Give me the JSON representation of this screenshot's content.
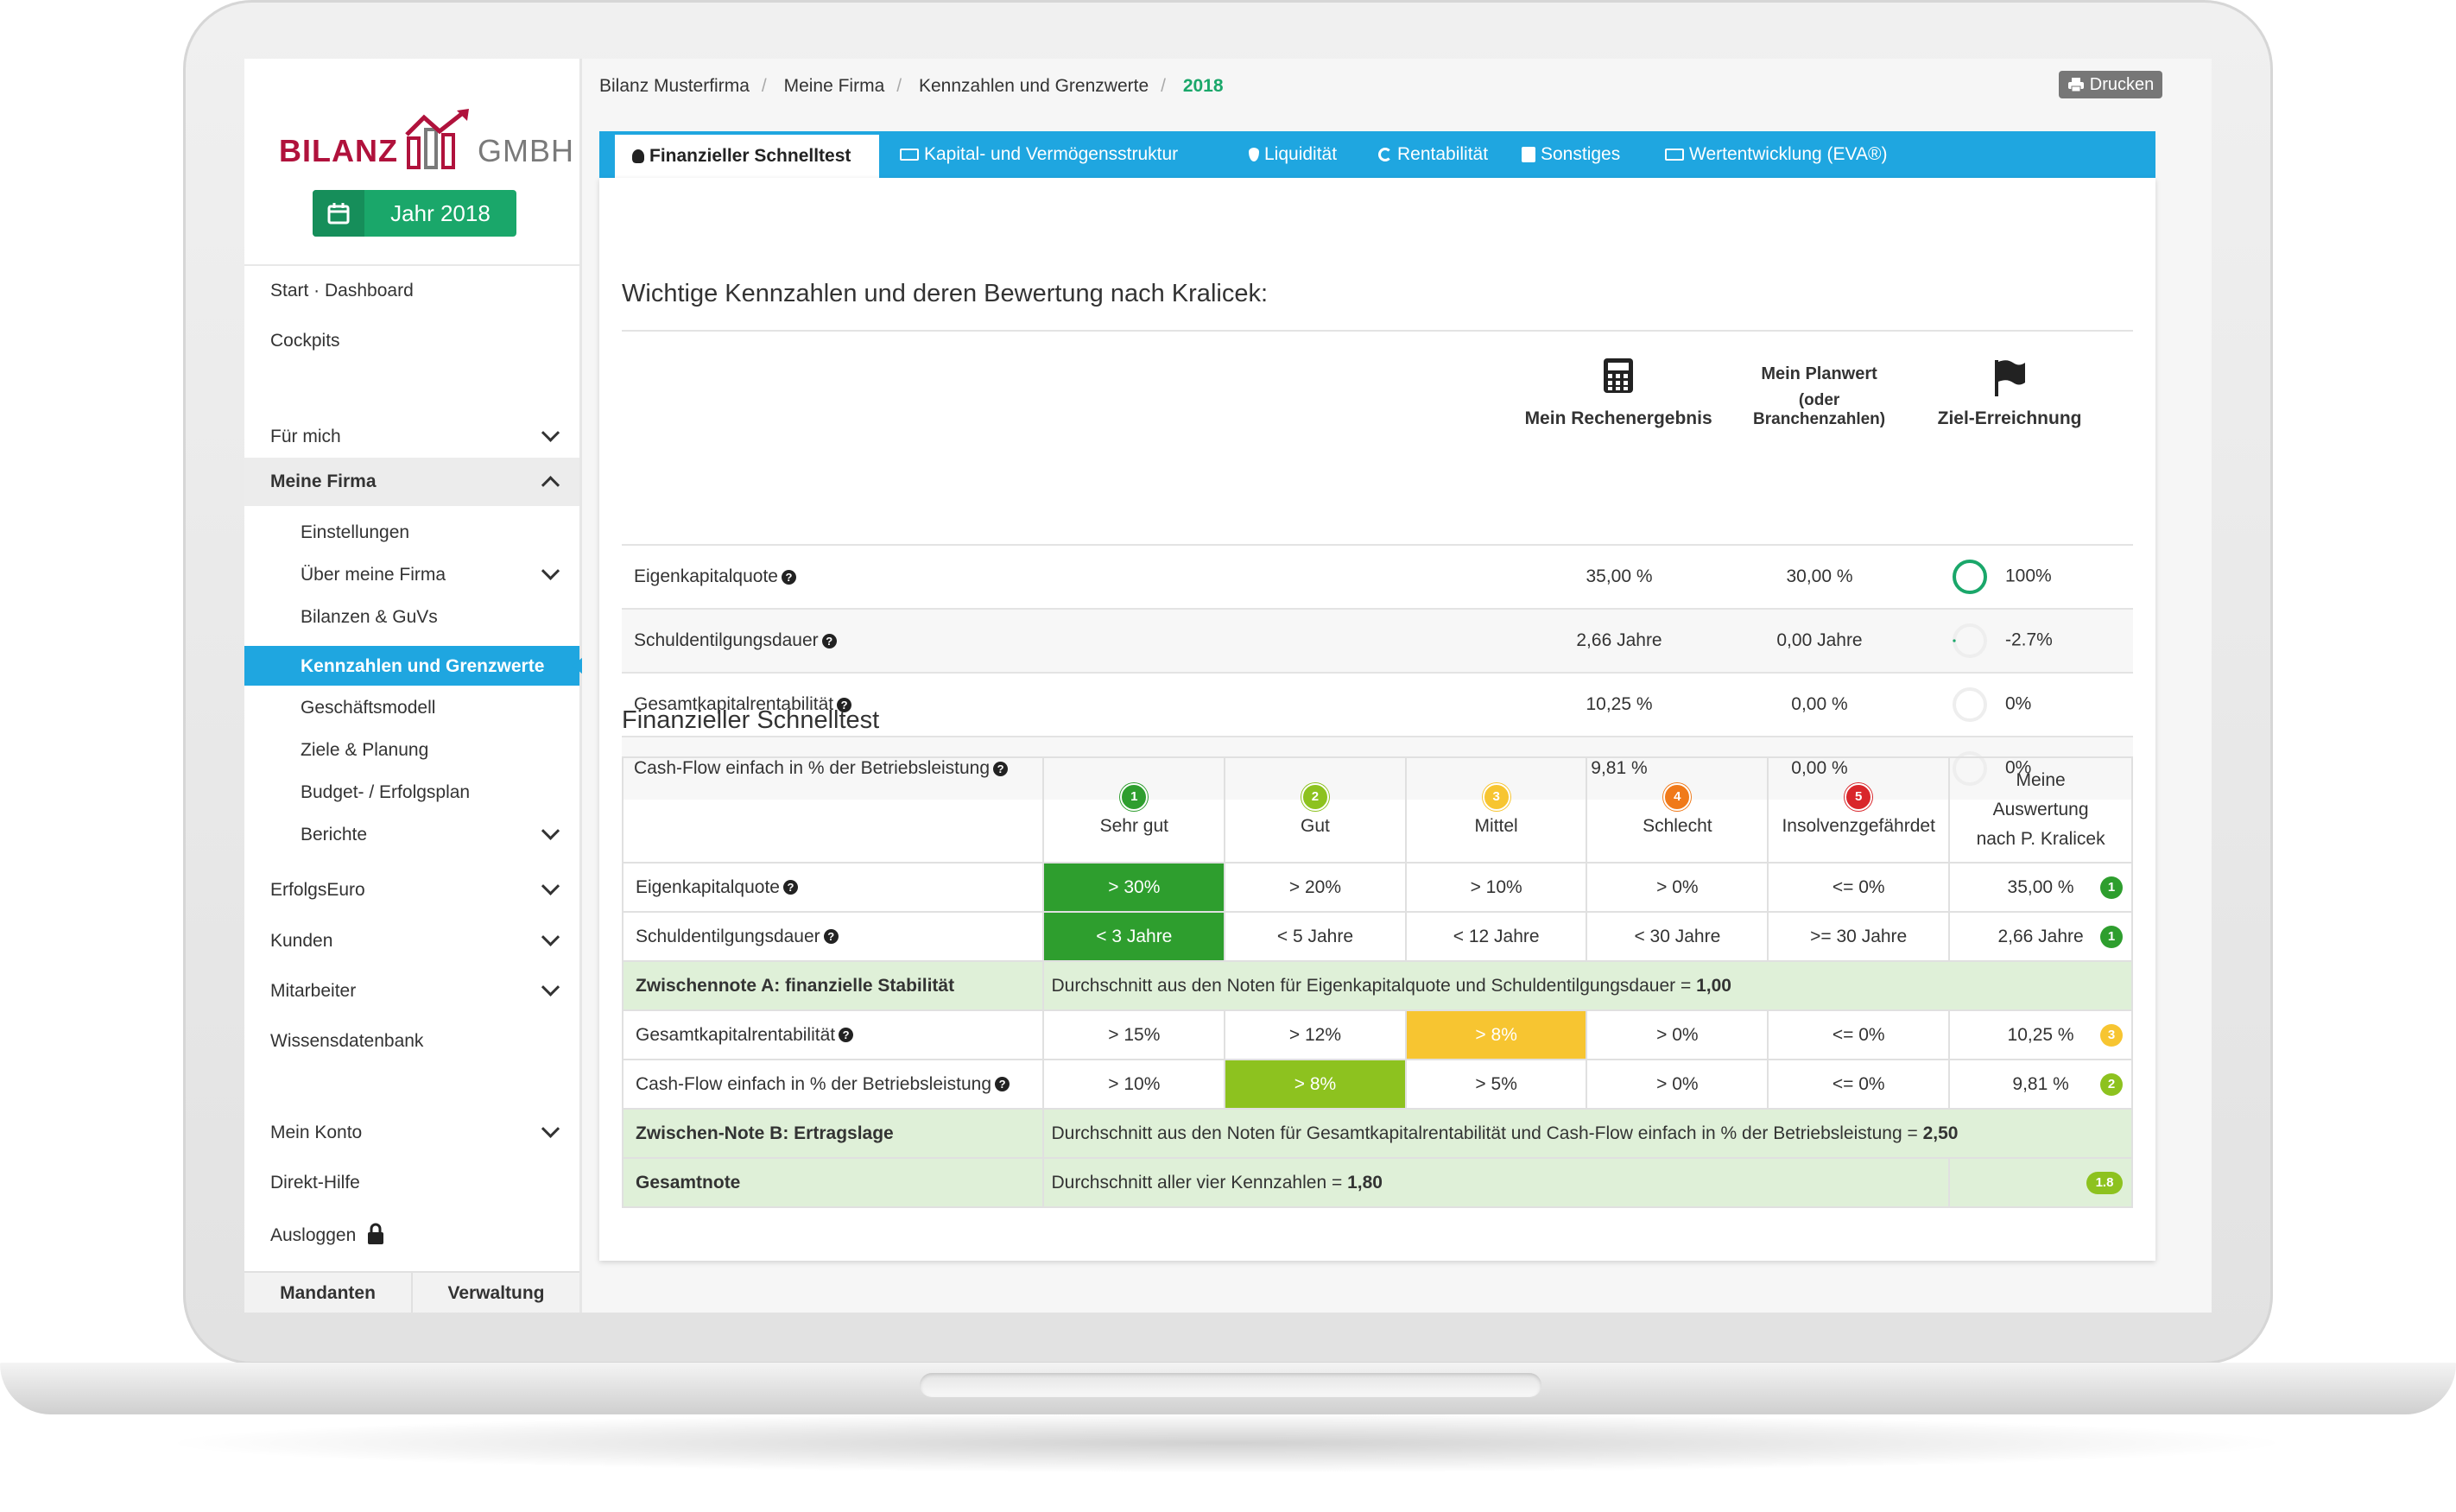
{
  "app": {
    "brand_left": "BILANZ",
    "brand_right": "GMBH",
    "year_label": "Jahr 2018"
  },
  "sidebar": {
    "items": [
      {
        "label": "Start · Dashboard"
      },
      {
        "label": "Cockpits"
      },
      {
        "label": "Für mich"
      },
      {
        "label": "Meine Firma"
      },
      {
        "label": "Einstellungen"
      },
      {
        "label": "Über meine Firma"
      },
      {
        "label": "Bilanzen & GuVs"
      },
      {
        "label": "Kennzahlen und Grenzwerte"
      },
      {
        "label": "Geschäftsmodell"
      },
      {
        "label": "Ziele & Planung"
      },
      {
        "label": "Budget- / Erfolgsplan"
      },
      {
        "label": "Berichte"
      },
      {
        "label": "ErfolgsEuro"
      },
      {
        "label": "Kunden"
      },
      {
        "label": "Mitarbeiter"
      },
      {
        "label": "Wissensdatenbank"
      },
      {
        "label": "Mein Konto"
      },
      {
        "label": "Direkt-Hilfe"
      },
      {
        "label": "Ausloggen"
      }
    ],
    "footer": {
      "mandanten": "Mandanten",
      "verwaltung": "Verwaltung"
    }
  },
  "breadcrumb": [
    "Bilanz Musterfirma",
    "Meine Firma",
    "Kennzahlen und Grenzwerte",
    "2018"
  ],
  "print_label": "Drucken",
  "tabs": [
    {
      "label": "Finanzieller Schnelltest"
    },
    {
      "label": "Kapital- und Vermögensstruktur"
    },
    {
      "label": "Liquidität"
    },
    {
      "label": "Rentabilität"
    },
    {
      "label": "Sonstiges"
    },
    {
      "label": "Wertentwicklung (EVA®)"
    }
  ],
  "kennzahlen": {
    "title": "Wichtige Kennzahlen und deren Bewertung nach Kralicek:",
    "headers": {
      "result": "Mein Rechenergebnis",
      "plan": "Mein Planwert",
      "plan_sub": "(oder Branchenzahlen)",
      "goal": "Ziel-Erreichnung"
    },
    "rows": [
      {
        "label": "Eigenkapitalquote",
        "result": "35,00 %",
        "plan": "30,00 %",
        "goal": "100%",
        "goal_fraction": 1.0
      },
      {
        "label": "Schuldentilgungsdauer",
        "result": "2,66 Jahre",
        "plan": "0,00 Jahre",
        "goal": "-2.7%",
        "goal_fraction": 0.0
      },
      {
        "label": "Gesamtkapitalrentabilität",
        "result": "10,25 %",
        "plan": "0,00 %",
        "goal": "0%",
        "goal_fraction": 0.0
      },
      {
        "label": "Cash-Flow einfach in % der Betriebsleistung",
        "result": "9,81 %",
        "plan": "0,00 %",
        "goal": "0%",
        "goal_fraction": 0.0
      }
    ]
  },
  "schnelltest": {
    "title": "Finanzieller Schnelltest",
    "grades": [
      {
        "num": "1",
        "label": "Sehr gut",
        "color": "#2e9e2e"
      },
      {
        "num": "2",
        "label": "Gut",
        "color": "#8dc21f"
      },
      {
        "num": "3",
        "label": "Mittel",
        "color": "#f7c531"
      },
      {
        "num": "4",
        "label": "Schlecht",
        "color": "#f07a1a"
      },
      {
        "num": "5",
        "label": "Insolvenzgefährdet",
        "color": "#d9262b"
      }
    ],
    "own_header": [
      "Meine",
      "Auswertung",
      "nach P. Kralicek"
    ],
    "rows": [
      {
        "label": "Eigenkapitalquote",
        "cells": [
          "> 30%",
          "> 20%",
          "> 10%",
          "> 0%",
          "<= 0%"
        ],
        "value": "35,00 %",
        "grade": "1",
        "hl": 0,
        "hl_color": "#2e9e2e"
      },
      {
        "label": "Schuldentilgungsdauer",
        "cells": [
          "< 3 Jahre",
          "< 5 Jahre",
          "< 12 Jahre",
          "< 30 Jahre",
          ">= 30 Jahre"
        ],
        "value": "2,66 Jahre",
        "grade": "1",
        "hl": 0,
        "hl_color": "#2e9e2e"
      },
      {
        "label": "Gesamtkapitalrentabilität",
        "cells": [
          "> 15%",
          "> 12%",
          "> 8%",
          "> 0%",
          "<= 0%"
        ],
        "value": "10,25 %",
        "grade": "3",
        "hl": 2,
        "hl_color": "#f7c531"
      },
      {
        "label": "Cash-Flow einfach in % der Betriebsleistung",
        "cells": [
          "> 10%",
          "> 8%",
          "> 5%",
          "> 0%",
          "<= 0%"
        ],
        "value": "9,81 %",
        "grade": "2",
        "hl": 1,
        "hl_color": "#8dc21f"
      }
    ],
    "sum_a": {
      "label": "Zwischennote A: finanzielle Stabilität",
      "text": "Durchschnitt aus den Noten für Eigenkapitalquote und Schuldentilgungsdauer = ",
      "value": "1,00"
    },
    "sum_b": {
      "label": "Zwischen-Note B: Ertragslage",
      "text": "Durchschnitt aus den Noten für Gesamtkapitalrentabilität und Cash-Flow einfach in % der Betriebsleistung = ",
      "value": "2,50"
    },
    "total": {
      "label": "Gesamtnote",
      "text": "Durchschnitt aller vier Kennzahlen = ",
      "value": "1,80",
      "badge": "1.8",
      "badge_color": "#8dc21f"
    }
  }
}
